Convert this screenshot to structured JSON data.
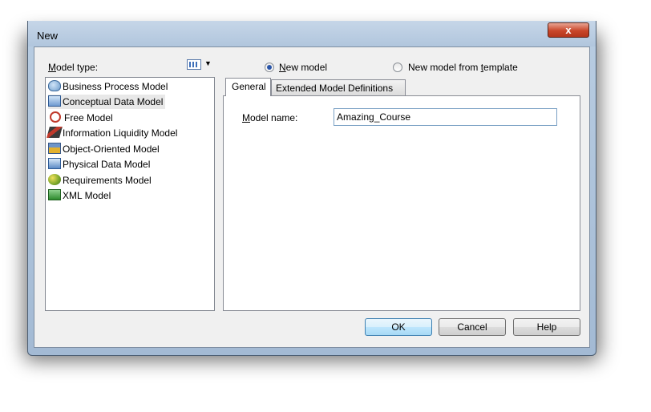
{
  "window": {
    "title": "New",
    "close_symbol": "x"
  },
  "left": {
    "model_type_label_accel": "M",
    "model_type_label_rest": "odel type:",
    "view_icon": "list-view-icon",
    "items": [
      {
        "label": "Business Process Model",
        "icon": "business-process-model-icon",
        "selected": false
      },
      {
        "label": "Conceptual Data Model",
        "icon": "conceptual-data-model-icon",
        "selected": true
      },
      {
        "label": "Free Model",
        "icon": "free-model-icon",
        "selected": false
      },
      {
        "label": "Information Liquidity Model",
        "icon": "information-liquidity-model-icon",
        "selected": false
      },
      {
        "label": "Object-Oriented Model",
        "icon": "object-oriented-model-icon",
        "selected": false
      },
      {
        "label": "Physical Data Model",
        "icon": "physical-data-model-icon",
        "selected": false
      },
      {
        "label": "Requirements Model",
        "icon": "requirements-model-icon",
        "selected": false
      },
      {
        "label": "XML Model",
        "icon": "xml-model-icon",
        "selected": false
      }
    ]
  },
  "radios": {
    "new_model_accel": "N",
    "new_model_rest": "ew model",
    "new_model_checked": true,
    "template_before": "New model from ",
    "template_accel": "t",
    "template_after": "emplate",
    "template_checked": false
  },
  "tabs": [
    {
      "label": "General",
      "active": true
    },
    {
      "label": "Extended Model Definitions",
      "active": false
    }
  ],
  "general": {
    "model_name_accel": "M",
    "model_name_rest": "odel name:",
    "model_name_value": "Amazing_Course"
  },
  "buttons": {
    "ok": "OK",
    "cancel": "Cancel",
    "help": "Help"
  },
  "colors": {
    "title_bar": "#b9cde2",
    "close_button": "#c9462a",
    "dialog_background": "#f0f0f0",
    "ok_button_highlight": "#3c7fb1"
  }
}
